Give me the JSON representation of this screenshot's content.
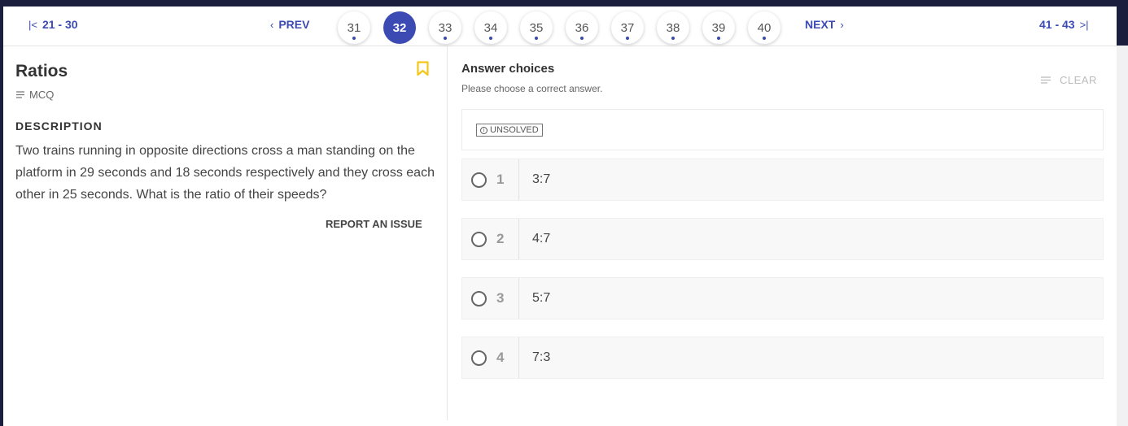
{
  "nav": {
    "first_range": "21 - 30",
    "prev_label": "PREV",
    "pages": [
      "31",
      "32",
      "33",
      "34",
      "35",
      "36",
      "37",
      "38",
      "39",
      "40"
    ],
    "active_page": "32",
    "next_label": "NEXT",
    "last_range": "41 - 43"
  },
  "question": {
    "title": "Ratios",
    "type": "MCQ",
    "description_heading": "DESCRIPTION",
    "description": "Two trains running in opposite directions cross a man standing on the platform in 29 seconds and 18 seconds respectively and they cross each other in 25 seconds. What is the ratio of their speeds?",
    "report_label": "REPORT AN ISSUE"
  },
  "answers": {
    "heading": "Answer choices",
    "subheading": "Please choose a correct answer.",
    "clear_label": "CLEAR",
    "status": "UNSOLVED",
    "choices": [
      {
        "num": "1",
        "text": "3:7"
      },
      {
        "num": "2",
        "text": "4:7"
      },
      {
        "num": "3",
        "text": "5:7"
      },
      {
        "num": "4",
        "text": "7:3"
      }
    ]
  },
  "colors": {
    "accent": "#3b4bb3",
    "bookmark": "#f5c518",
    "header_bg": "#1b1e3d"
  },
  "icons": {
    "first": "first-page-icon",
    "prev": "chevron-left-icon",
    "next": "chevron-right-icon",
    "last": "last-page-icon",
    "bookmark": "bookmark-icon",
    "type": "lines-icon",
    "clear": "clear-lines-icon",
    "status": "info-icon"
  }
}
